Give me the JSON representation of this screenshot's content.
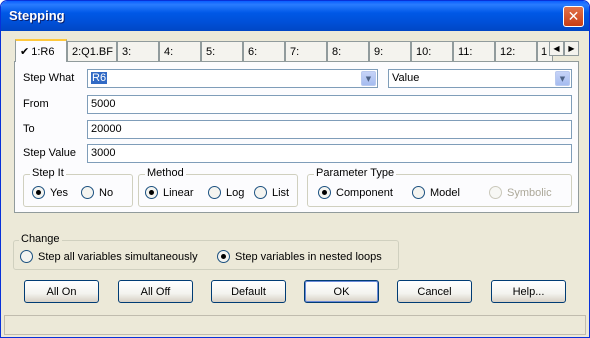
{
  "window": {
    "title": "Stepping"
  },
  "tabs": [
    {
      "label": "1:R6",
      "active": true
    },
    {
      "label": "2:Q1.BF"
    },
    {
      "label": "3:"
    },
    {
      "label": "4:"
    },
    {
      "label": "5:"
    },
    {
      "label": "6:"
    },
    {
      "label": "7:"
    },
    {
      "label": "8:"
    },
    {
      "label": "9:"
    },
    {
      "label": "10:"
    },
    {
      "label": "11:"
    },
    {
      "label": "12:"
    },
    {
      "label": "1"
    }
  ],
  "form": {
    "step_what_label": "Step What",
    "step_what_value": "R6",
    "property_value": "Value",
    "from_label": "From",
    "from_value": "5000",
    "to_label": "To",
    "to_value": "20000",
    "step_value_label": "Step Value",
    "step_value_value": "3000"
  },
  "step_it": {
    "title": "Step It",
    "options": [
      {
        "label": "Yes",
        "selected": true
      },
      {
        "label": "No",
        "selected": false
      }
    ]
  },
  "method": {
    "title": "Method",
    "options": [
      {
        "label": "Linear",
        "selected": true
      },
      {
        "label": "Log",
        "selected": false
      },
      {
        "label": "List",
        "selected": false
      }
    ]
  },
  "parameter_type": {
    "title": "Parameter Type",
    "options": [
      {
        "label": "Component",
        "selected": true
      },
      {
        "label": "Model",
        "selected": false
      },
      {
        "label": "Symbolic",
        "selected": false,
        "disabled": true
      }
    ]
  },
  "change": {
    "title": "Change",
    "options": [
      {
        "label": "Step all variables simultaneously",
        "selected": false
      },
      {
        "label": "Step variables in nested loops",
        "selected": true
      }
    ]
  },
  "buttons": {
    "all_on": "All On",
    "all_off": "All Off",
    "default": "Default",
    "ok": "OK",
    "cancel": "Cancel",
    "help": "Help..."
  },
  "icons": {
    "close": "close-icon",
    "check": "check-icon",
    "left": "arrow-left-icon",
    "right": "arrow-right-icon",
    "dropdown": "chevron-down-icon"
  }
}
